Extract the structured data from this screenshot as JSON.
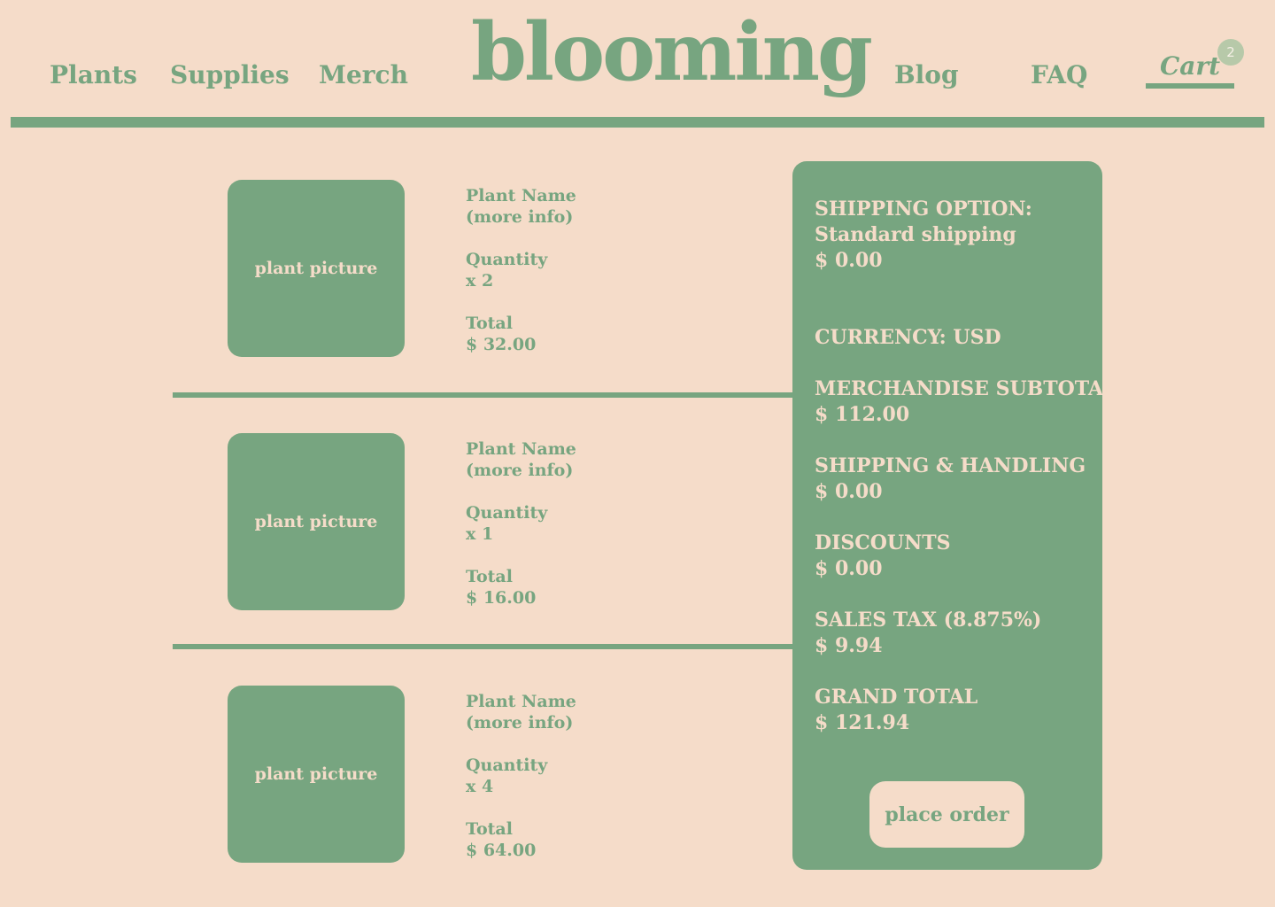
{
  "nav": {
    "left": [
      "Plants",
      "Supplies",
      "Merch"
    ],
    "logo": "blooming",
    "right": [
      "Blog",
      "FAQ"
    ],
    "cart_label": "Cart",
    "cart_count": "2"
  },
  "items": [
    {
      "image_label": "plant picture",
      "name": "Plant Name",
      "more_info": "(more info)",
      "quantity_label": "Quantity",
      "quantity": "x 2",
      "total_label": "Total",
      "total": "$ 32.00"
    },
    {
      "image_label": "plant picture",
      "name": "Plant Name",
      "more_info": "(more info)",
      "quantity_label": "Quantity",
      "quantity": "x 1",
      "total_label": "Total",
      "total": "$ 16.00"
    },
    {
      "image_label": "plant picture",
      "name": "Plant Name",
      "more_info": "(more info)",
      "quantity_label": "Quantity",
      "quantity": "x 4",
      "total_label": "Total",
      "total": "$ 64.00"
    }
  ],
  "summary": {
    "shipping_option_label": "SHIPPING OPTION:",
    "shipping_option_value": "Standard shipping",
    "shipping_option_price": "$ 0.00",
    "currency": "CURRENCY: USD",
    "subtotal_label": "MERCHANDISE SUBTOTAL",
    "subtotal_value": "$ 112.00",
    "shipping_handling_label": "SHIPPING & HANDLING",
    "shipping_handling_value": "$ 0.00",
    "discounts_label": "DISCOUNTS",
    "discounts_value": "$ 0.00",
    "tax_label": "SALES TAX (8.875%)",
    "tax_value": "$ 9.94",
    "grand_total_label": "GRAND TOTAL",
    "grand_total_value": "$ 121.94",
    "place_order": "place order"
  },
  "colors": {
    "background": "#f5dcc9",
    "accent": "#77a580",
    "badge": "#b7c9a9"
  }
}
